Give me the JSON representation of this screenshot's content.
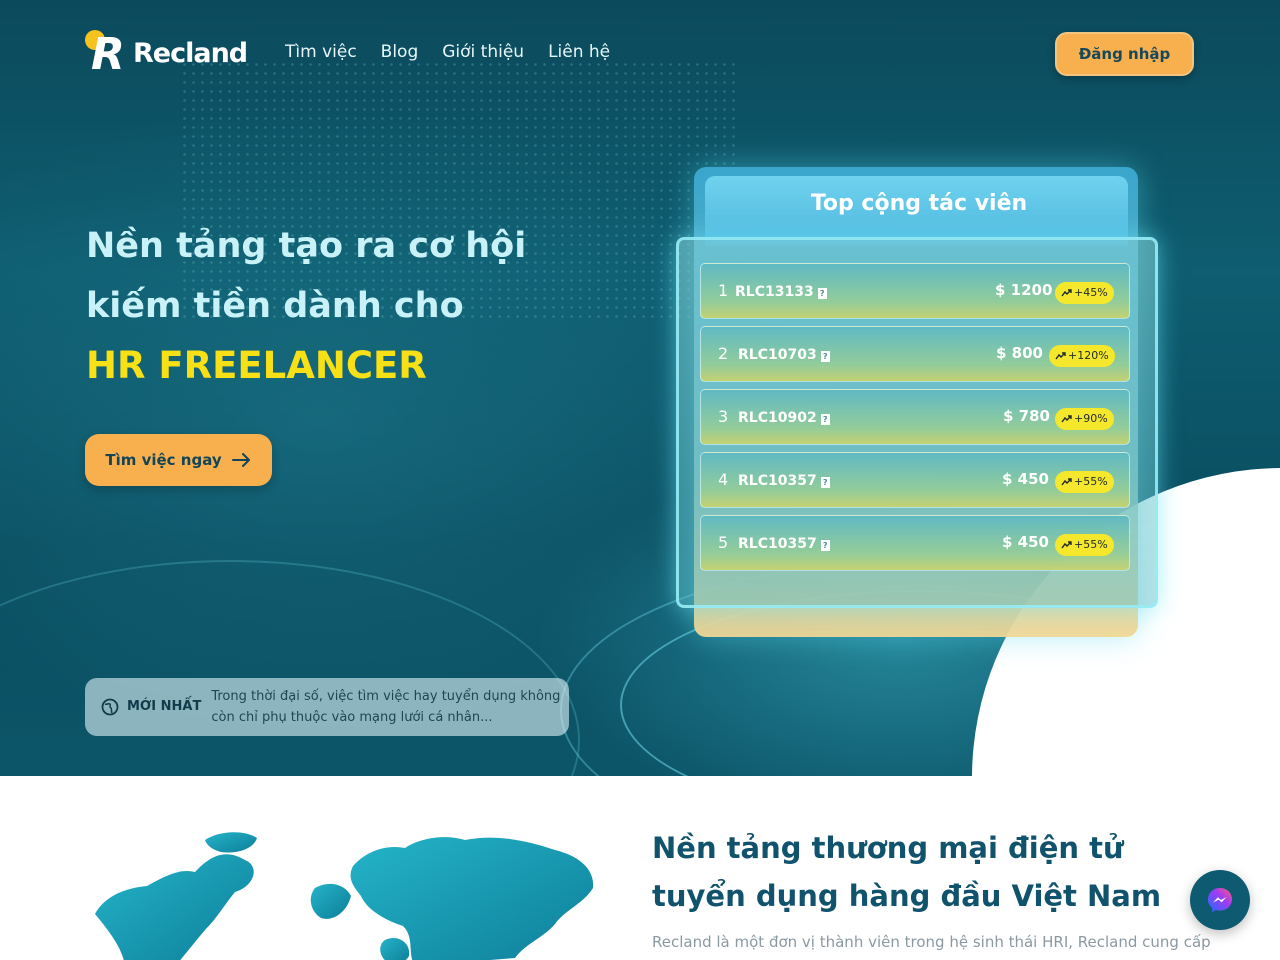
{
  "brand": {
    "name": "Recland",
    "dot_color": "#f6c21d",
    "accent_color": "#f8b04f"
  },
  "nav": {
    "links": [
      "Tìm việc",
      "Blog",
      "Giới thiệu",
      "Liên hệ"
    ],
    "login_label": "Đăng nhập"
  },
  "hero": {
    "line1": "Nền tảng tạo ra cơ hội",
    "line2": "kiếm tiền dành cho",
    "accent": "HR FREELANCER",
    "accent_color": "#f7e016",
    "cta_label": "Tìm việc ngay",
    "cta_icon": "arrow-right-icon"
  },
  "news": {
    "icon": "globe-icon",
    "tag": "MỚI NHẤT",
    "text": "Trong thời đại số, việc tìm việc hay tuyển dụng không còn chỉ phụ thuộc vào mạng lưới cá nhân..."
  },
  "leaderboard": {
    "title": "Top cộng tác viên",
    "rows": [
      {
        "rank": "1",
        "id": "RLC13133",
        "amount": "$ 1200",
        "change": "+45%"
      },
      {
        "rank": "2",
        "id": "RLC10703",
        "amount": "$ 800",
        "change": "+120%"
      },
      {
        "rank": "3",
        "id": "RLC10902",
        "amount": "$ 780",
        "change": "+90%"
      },
      {
        "rank": "4",
        "id": "RLC10357",
        "amount": "$ 450",
        "change": "+55%"
      },
      {
        "rank": "5",
        "id": "RLC10357",
        "amount": "$ 450",
        "change": "+55%"
      }
    ],
    "badge_color": "#f5e72c"
  },
  "section": {
    "title": "Nền tảng thương mại điện tử tuyển dụng hàng đầu Việt Nam",
    "body": "Recland là một đơn vị thành viên trong hệ sinh thái HRI, Recland cung cấp"
  },
  "chat": {
    "icon": "messenger-icon"
  }
}
